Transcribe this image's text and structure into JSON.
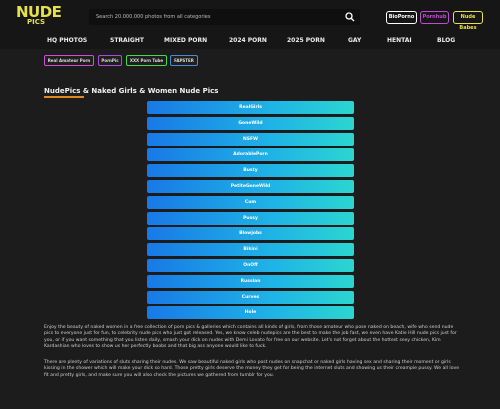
{
  "header": {
    "logo_top": "NUDE",
    "logo_bottom": "PICS",
    "search_placeholder": "Search 20.000.000 photos from all categories",
    "buttons": [
      {
        "label": "BioPorno",
        "color": "#ffffff"
      },
      {
        "label": "Pornhub",
        "color": "#c24bd6"
      },
      {
        "label": "Nude Babes",
        "color": "#e6e04a"
      }
    ]
  },
  "nav": {
    "items": [
      "HQ PHOTOS",
      "STRAIGHT",
      "MIXED PORN",
      "2024 PORN",
      "2025 PORN",
      "GAY",
      "HENTAI",
      "BLOG"
    ]
  },
  "tags": [
    {
      "label": "Real Amateur Porn",
      "color": "#d44bd6"
    },
    {
      "label": "PornPic",
      "color": "#b04bd6"
    },
    {
      "label": "XXX Porn Tube",
      "color": "#4bd64b"
    },
    {
      "label": "FAPSTER",
      "color": "#4b8bd6"
    }
  ],
  "main": {
    "title": "NudePics & Naked Girls & Women Nude Pics",
    "links": [
      "RealGirls",
      "GoneWild",
      "NSFW",
      "AdorablePorn",
      "Busty",
      "PetiteGoneWild",
      "Cum",
      "Pussy",
      "Blowjobs",
      "Bikini",
      "OnOff",
      "Russian",
      "Curves",
      "Hole"
    ],
    "paragraphs": [
      "Enjoy the beauty of naked women in a free collection of porn pics & galleries which contains all kinds of girls, from those amateur who pose naked on beach, wife who send nude pics to everyone just for fun, to celebrity nude pics who just got released. Yes, we know celeb nudepics are the best to make the job fast, we even have Katie Hill nude pics just for you, or if you want something that you listen daily, smash your dick on nudes with Demi Lovato for free on our website. Let's not forget about the hottest sexy chicken, Kim Kardashian who loves to show us her perfectly boobs and that big ass anyone would like to fuck.",
      "There are plenty of variations of sluts sharing their nudes. We saw beautiful naked girls who post nudes on snapchat or naked girls having sex and sharing their moment or girls kissing in the shower which will make your dick so hard. Those pretty girls deserve the money they get for being the internet sluts and showing us their creampie pussy. We all love fit and pretty girls, and make sure you will also check the pictures we gathered from tumblr for you."
    ]
  }
}
